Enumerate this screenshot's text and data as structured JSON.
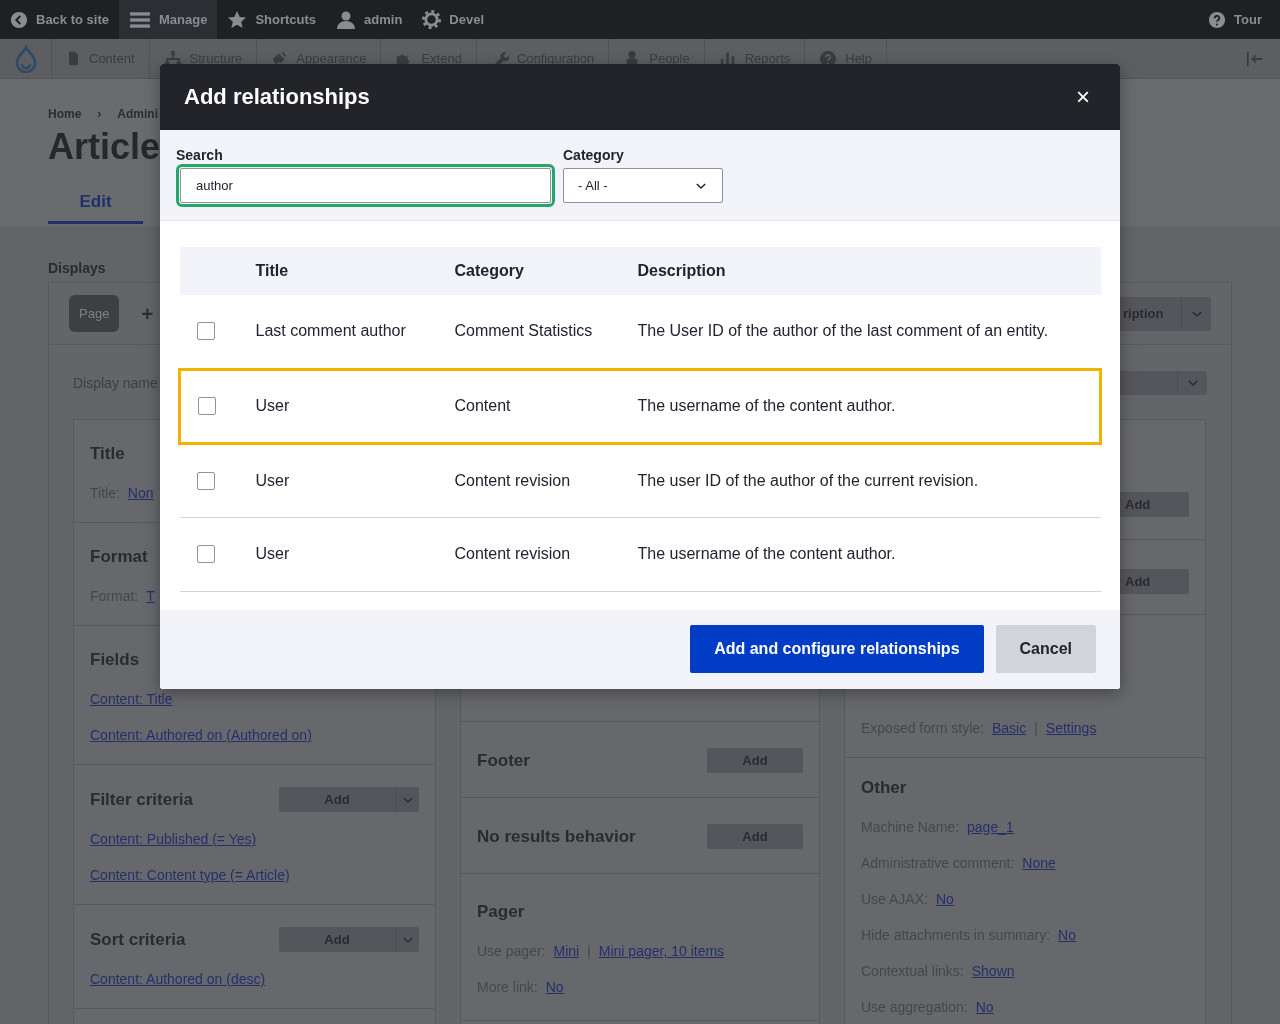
{
  "toolbar": {
    "items": [
      {
        "label": "Back to site",
        "selected": false
      },
      {
        "label": "Manage",
        "selected": true
      },
      {
        "label": "Shortcuts",
        "selected": false
      },
      {
        "label": "admin",
        "selected": false
      },
      {
        "label": "Devel",
        "selected": false
      }
    ],
    "tour": "Tour"
  },
  "admin_menu": {
    "items": [
      "Content",
      "Structure",
      "Appearance",
      "Extend",
      "Configuration",
      "People",
      "Reports",
      "Help"
    ]
  },
  "breadcrumb": {
    "items": [
      "Home",
      "Admini"
    ],
    "separator": "›"
  },
  "page_title": "Article",
  "tabs": [
    {
      "label": "Edit",
      "selected": true
    }
  ],
  "displays": {
    "label": "Displays",
    "display_tabs": [
      {
        "label": "Page",
        "selected": true
      }
    ],
    "add_display": "+",
    "menu_button": "ription",
    "display_name_label": "Display name"
  },
  "columns": [
    {
      "sections": [
        {
          "title": "Title",
          "lines": [
            {
              "kind": "setting",
              "label": "Title:",
              "links": [
                "Non"
              ]
            }
          ]
        },
        {
          "title": "Format",
          "lines": [
            {
              "kind": "setting",
              "label": "Format:",
              "links": [
                "T"
              ]
            }
          ]
        },
        {
          "title": "Fields",
          "lines": [
            {
              "kind": "link",
              "text": "Content: Title"
            },
            {
              "kind": "link",
              "text": "Content: Authored on (Authored on)"
            }
          ]
        },
        {
          "title": "Filter criteria",
          "add": {
            "label": "Add",
            "dropdown": true
          },
          "lines": [
            {
              "kind": "link",
              "text": "Content: Published (= Yes)"
            },
            {
              "kind": "link",
              "text": "Content: Content type (= Article)"
            }
          ]
        },
        {
          "title": "Sort criteria",
          "add": {
            "label": "Add",
            "dropdown": true
          },
          "lines": [
            {
              "kind": "link",
              "text": "Content: Authored on (desc)"
            }
          ]
        }
      ]
    },
    {
      "sections": [
        {
          "title": "Footer",
          "add": {
            "label": "Add",
            "dropdown": false
          }
        },
        {
          "title": "No results behavior",
          "add": {
            "label": "Add",
            "dropdown": false
          }
        },
        {
          "title": "Pager",
          "lines": [
            {
              "kind": "setting",
              "label": "Use pager:",
              "links": [
                "Mini",
                "Mini pager, 10 items"
              ],
              "separator": "|"
            },
            {
              "kind": "setting",
              "label": "More link:",
              "links": [
                "No"
              ]
            }
          ]
        }
      ]
    },
    {
      "sections": [
        {
          "add": {
            "label": "Add",
            "dropdown": false
          }
        },
        {
          "add": {
            "label": "Add",
            "dropdown": false
          }
        },
        {
          "lines": [
            {
              "kind": "setting",
              "label": "Exposed form style:",
              "links": [
                "Basic",
                "Settings"
              ],
              "separator": "|"
            }
          ]
        },
        {
          "title": "Other",
          "lines": [
            {
              "kind": "setting",
              "label": "Machine Name:",
              "links": [
                "page_1"
              ]
            },
            {
              "kind": "setting",
              "label": "Administrative comment:",
              "links": [
                "None"
              ]
            },
            {
              "kind": "setting",
              "label": "Use AJAX:",
              "links": [
                "No"
              ]
            },
            {
              "kind": "setting",
              "label": "Hide attachments in summary:",
              "links": [
                "No"
              ]
            },
            {
              "kind": "setting",
              "label": "Contextual links:",
              "links": [
                "Shown"
              ]
            },
            {
              "kind": "setting",
              "label": "Use aggregation:",
              "links": [
                "No"
              ]
            }
          ]
        }
      ]
    }
  ],
  "modal": {
    "title": "Add relationships",
    "close": "×",
    "search": {
      "label": "Search",
      "value": "author"
    },
    "category": {
      "label": "Category",
      "value": "- All -"
    },
    "table": {
      "columns": [
        "Title",
        "Category",
        "Description"
      ],
      "rows": [
        {
          "checked": false,
          "highlighted": false,
          "cells": [
            "Last comment author",
            "Comment Statistics",
            "The User ID of the author of the last comment of an entity."
          ]
        },
        {
          "checked": false,
          "highlighted": true,
          "cells": [
            "User",
            "Content",
            "The username of the content author."
          ]
        },
        {
          "checked": false,
          "highlighted": false,
          "cells": [
            "User",
            "Content revision",
            "The user ID of the author of the current revision."
          ]
        },
        {
          "checked": false,
          "highlighted": false,
          "cells": [
            "User",
            "Content revision",
            "The username of the content author."
          ]
        }
      ]
    },
    "buttons": [
      {
        "label": "Add and configure relationships",
        "kind": "primary"
      },
      {
        "label": "Cancel",
        "kind": "secondary"
      }
    ]
  }
}
